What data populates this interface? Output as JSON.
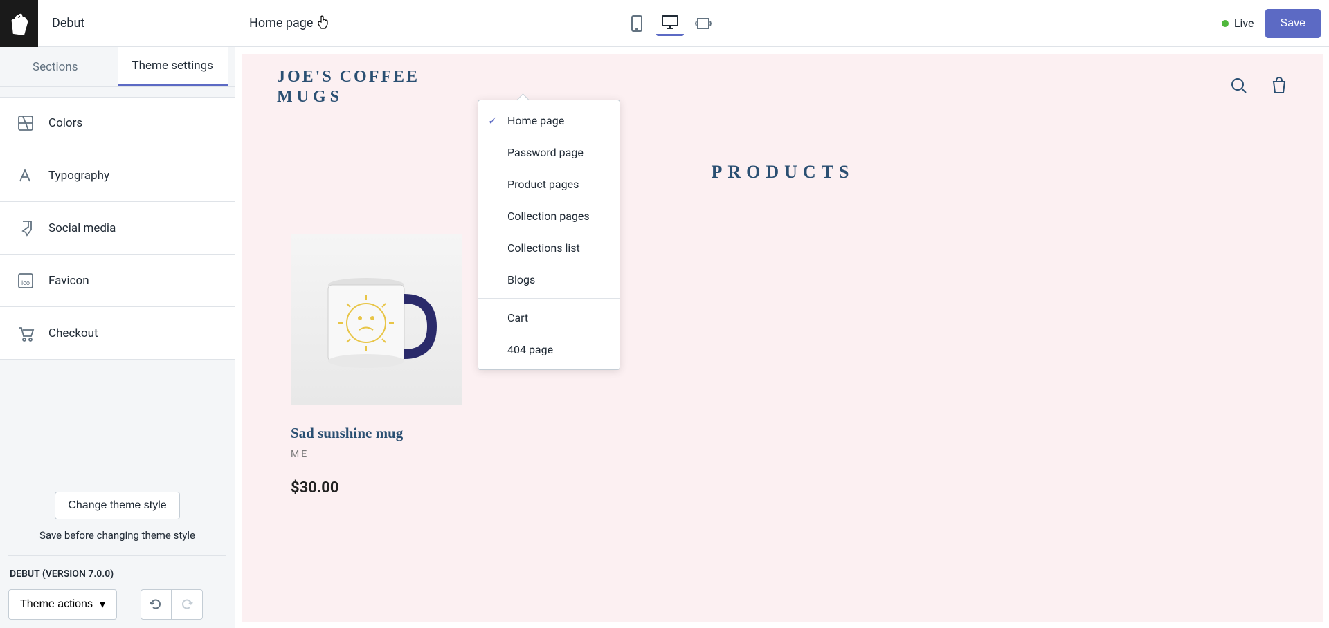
{
  "header": {
    "theme_name": "Debut",
    "page_selector_label": "Home page",
    "live_label": "Live",
    "save_label": "Save"
  },
  "tabs": {
    "sections": "Sections",
    "settings": "Theme settings"
  },
  "settings": [
    {
      "label": "Colors"
    },
    {
      "label": "Typography"
    },
    {
      "label": "Social media"
    },
    {
      "label": "Favicon"
    },
    {
      "label": "Checkout"
    }
  ],
  "bottom": {
    "change_style": "Change theme style",
    "warning": "Save before changing theme style",
    "version": "DEBUT (VERSION 7.0.0)",
    "theme_actions": "Theme actions"
  },
  "dropdown": [
    {
      "label": "Home page",
      "selected": true
    },
    {
      "label": "Password page"
    },
    {
      "label": "Product pages"
    },
    {
      "label": "Collection pages"
    },
    {
      "label": "Collections list"
    },
    {
      "label": "Blogs"
    },
    {
      "label": "Cart",
      "divider_before": true
    },
    {
      "label": "404 page"
    }
  ],
  "store": {
    "brand_line1": "JOE'S COFFEE",
    "brand_line2": "MUGS",
    "products_heading": "PRODUCTS",
    "product": {
      "title": "Sad sunshine mug",
      "vendor": "ME",
      "price": "$30.00"
    }
  }
}
